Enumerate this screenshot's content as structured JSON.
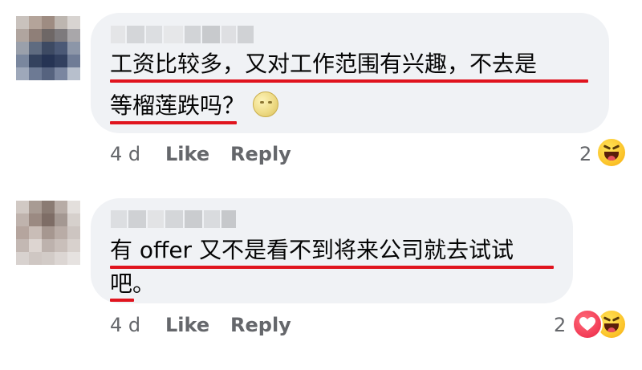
{
  "comments": [
    {
      "lines": [
        "工资比较多，又对工作范围有兴趣，不去是",
        "等榴莲跌吗？"
      ],
      "emoji": "moon-face-icon",
      "time": "4 d",
      "like_label": "Like",
      "reply_label": "Reply",
      "reaction_count": "2",
      "reactions": [
        "haha-icon"
      ]
    },
    {
      "lines": [
        "有 offer 又不是看不到将来公司就去试试",
        "吧。"
      ],
      "time": "4 d",
      "like_label": "Like",
      "reply_label": "Reply",
      "reaction_count": "2",
      "reactions": [
        "love-icon",
        "haha-icon"
      ]
    }
  ],
  "colors": {
    "bubble": "#f0f2f5",
    "underline": "#e0141e",
    "meta_text": "#65676b",
    "body_text": "#050505"
  }
}
